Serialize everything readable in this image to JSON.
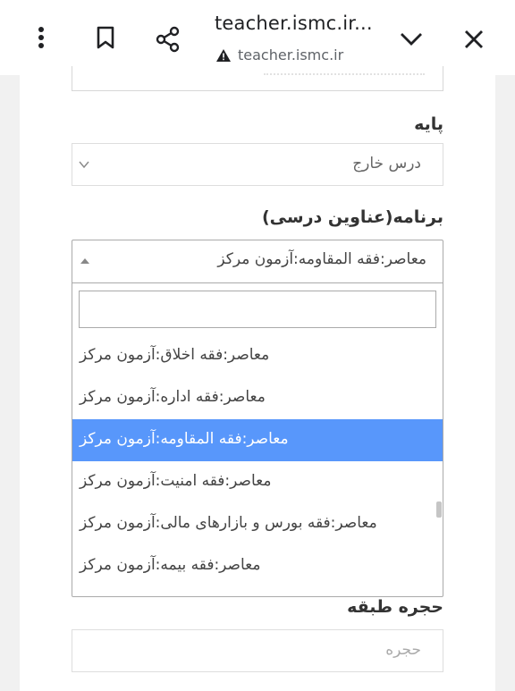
{
  "browser": {
    "page_title": "teacher.ismc.ir...",
    "url": "teacher.ismc.ir"
  },
  "form": {
    "paye": {
      "label": "پایه",
      "value": "درس خارج"
    },
    "barname": {
      "label": "برنامه(عناوین درسی)",
      "selected": "معاصر:فقه المقاومه:آزمون مرکز",
      "search_value": "",
      "options": [
        {
          "label": "معاصر:فقه اخلاق:آزمون مرکز",
          "selected": false
        },
        {
          "label": "معاصر:فقه اداره:آزمون مرکز",
          "selected": false
        },
        {
          "label": "معاصر:فقه المقاومه:آزمون مرکز",
          "selected": true
        },
        {
          "label": "معاصر:فقه امنیت:آزمون مرکز",
          "selected": false
        },
        {
          "label": "معاصر:فقه بورس و بازارهای مالی:آزمون مرکز",
          "selected": false
        },
        {
          "label": "معاصر:فقه بیمه:آزمون مرکز",
          "selected": false
        }
      ]
    },
    "hojre": {
      "label": "حجره طبقه",
      "placeholder": "حجره"
    }
  },
  "colors": {
    "highlight": "#5897fb",
    "page_bg": "#f1f1f1"
  },
  "icons": [
    "more-vert-icon",
    "bookmark-icon",
    "share-icon",
    "chevron-down-icon",
    "close-icon",
    "warning-icon"
  ]
}
